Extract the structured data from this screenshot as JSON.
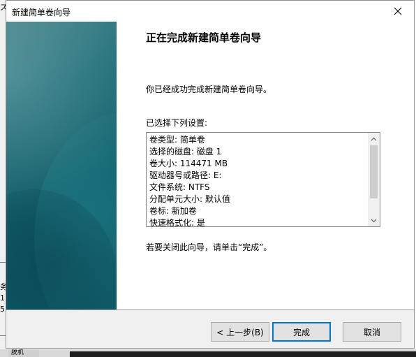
{
  "background": {
    "left_fragments": [
      "ズ",
      "务",
      "1",
      "5"
    ],
    "bottom_tab": "脱机"
  },
  "dialog": {
    "title": "新建简单卷向导",
    "heading": "正在完成新建简单卷向导",
    "success_text": "你已经成功完成新建简单卷向导。",
    "selected_label": "已选择下列设置:",
    "settings": [
      "卷类型: 简单卷",
      "选择的磁盘: 磁盘 1",
      "卷大小: 114471 MB",
      "驱动器号或路径: E:",
      "文件系统: NTFS",
      "分配单元大小: 默认值",
      "卷标: 新加卷",
      "快速格式化: 是"
    ],
    "close_hint": "若要关闭此向导，请单击“完成”。",
    "buttons": {
      "back": "< 上一步(B)",
      "finish": "完成",
      "cancel": "取消"
    }
  },
  "colors": {
    "side_panel": "#0f5c68",
    "default_button_border": "#0078d7",
    "footer_bg": "#f0f0f0"
  }
}
